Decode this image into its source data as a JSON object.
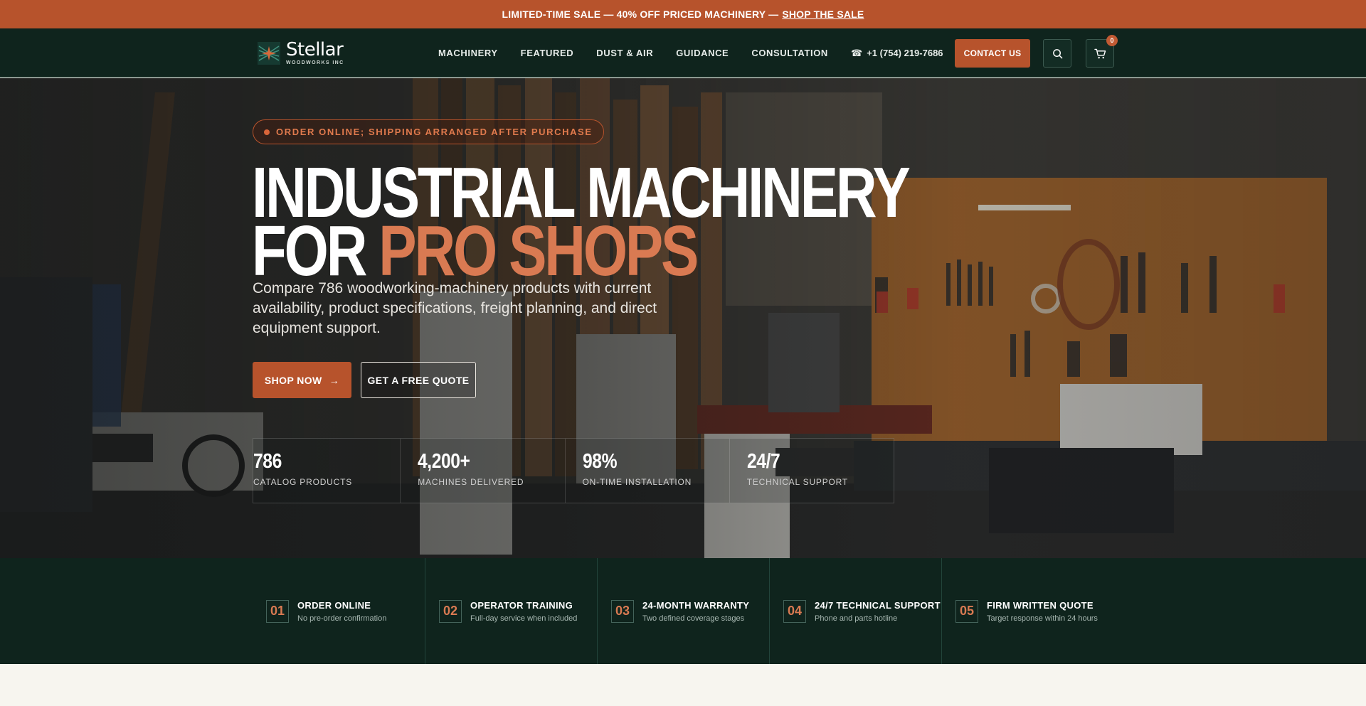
{
  "promo": {
    "text": "LIMITED-TIME SALE — 40% OFF PRICED MACHINERY —",
    "link": "SHOP THE SALE"
  },
  "header": {
    "logo_name": "Stellar",
    "logo_sub": "WOODWORKS INC",
    "nav": [
      "MACHINERY",
      "FEATURED",
      "DUST & AIR",
      "GUIDANCE",
      "CONSULTATION"
    ],
    "phone": "+1 (754) 219-7686",
    "contact_label": "CONTACT US",
    "cart_count": "0"
  },
  "hero": {
    "pill": "ORDER ONLINE; SHIPPING ARRANGED AFTER PURCHASE",
    "headline_line1": "INDUSTRIAL MACHINERY",
    "headline_line2_plain": "FOR ",
    "headline_line2_accent": "PRO SHOPS",
    "subtext": "Compare 786 woodworking-machinery products with current availability, product specifications, freight planning, and direct equipment support.",
    "shop_label": "SHOP NOW",
    "shop_arrow": "→",
    "quote_label": "GET A FREE QUOTE",
    "stats": [
      {
        "value": "786",
        "label": "CATALOG PRODUCTS"
      },
      {
        "value": "4,200+",
        "label": "MACHINES DELIVERED"
      },
      {
        "value": "98%",
        "label": "ON-TIME INSTALLATION"
      },
      {
        "value": "24/7",
        "label": "TECHNICAL SUPPORT"
      }
    ]
  },
  "features": [
    {
      "num": "01",
      "title": "ORDER ONLINE",
      "desc": "No pre-order confirmation"
    },
    {
      "num": "02",
      "title": "OPERATOR TRAINING",
      "desc": "Full-day service when included"
    },
    {
      "num": "03",
      "title": "24-MONTH WARRANTY",
      "desc": "Two defined coverage stages"
    },
    {
      "num": "04",
      "title": "24/7 TECHNICAL SUPPORT",
      "desc": "Phone and parts hotline"
    },
    {
      "num": "05",
      "title": "FIRM WRITTEN QUOTE",
      "desc": "Target response within 24 hours"
    }
  ],
  "colors": {
    "accent": "#b7532c",
    "dark_green": "#0f241d",
    "headline_accent": "#d97a52"
  }
}
